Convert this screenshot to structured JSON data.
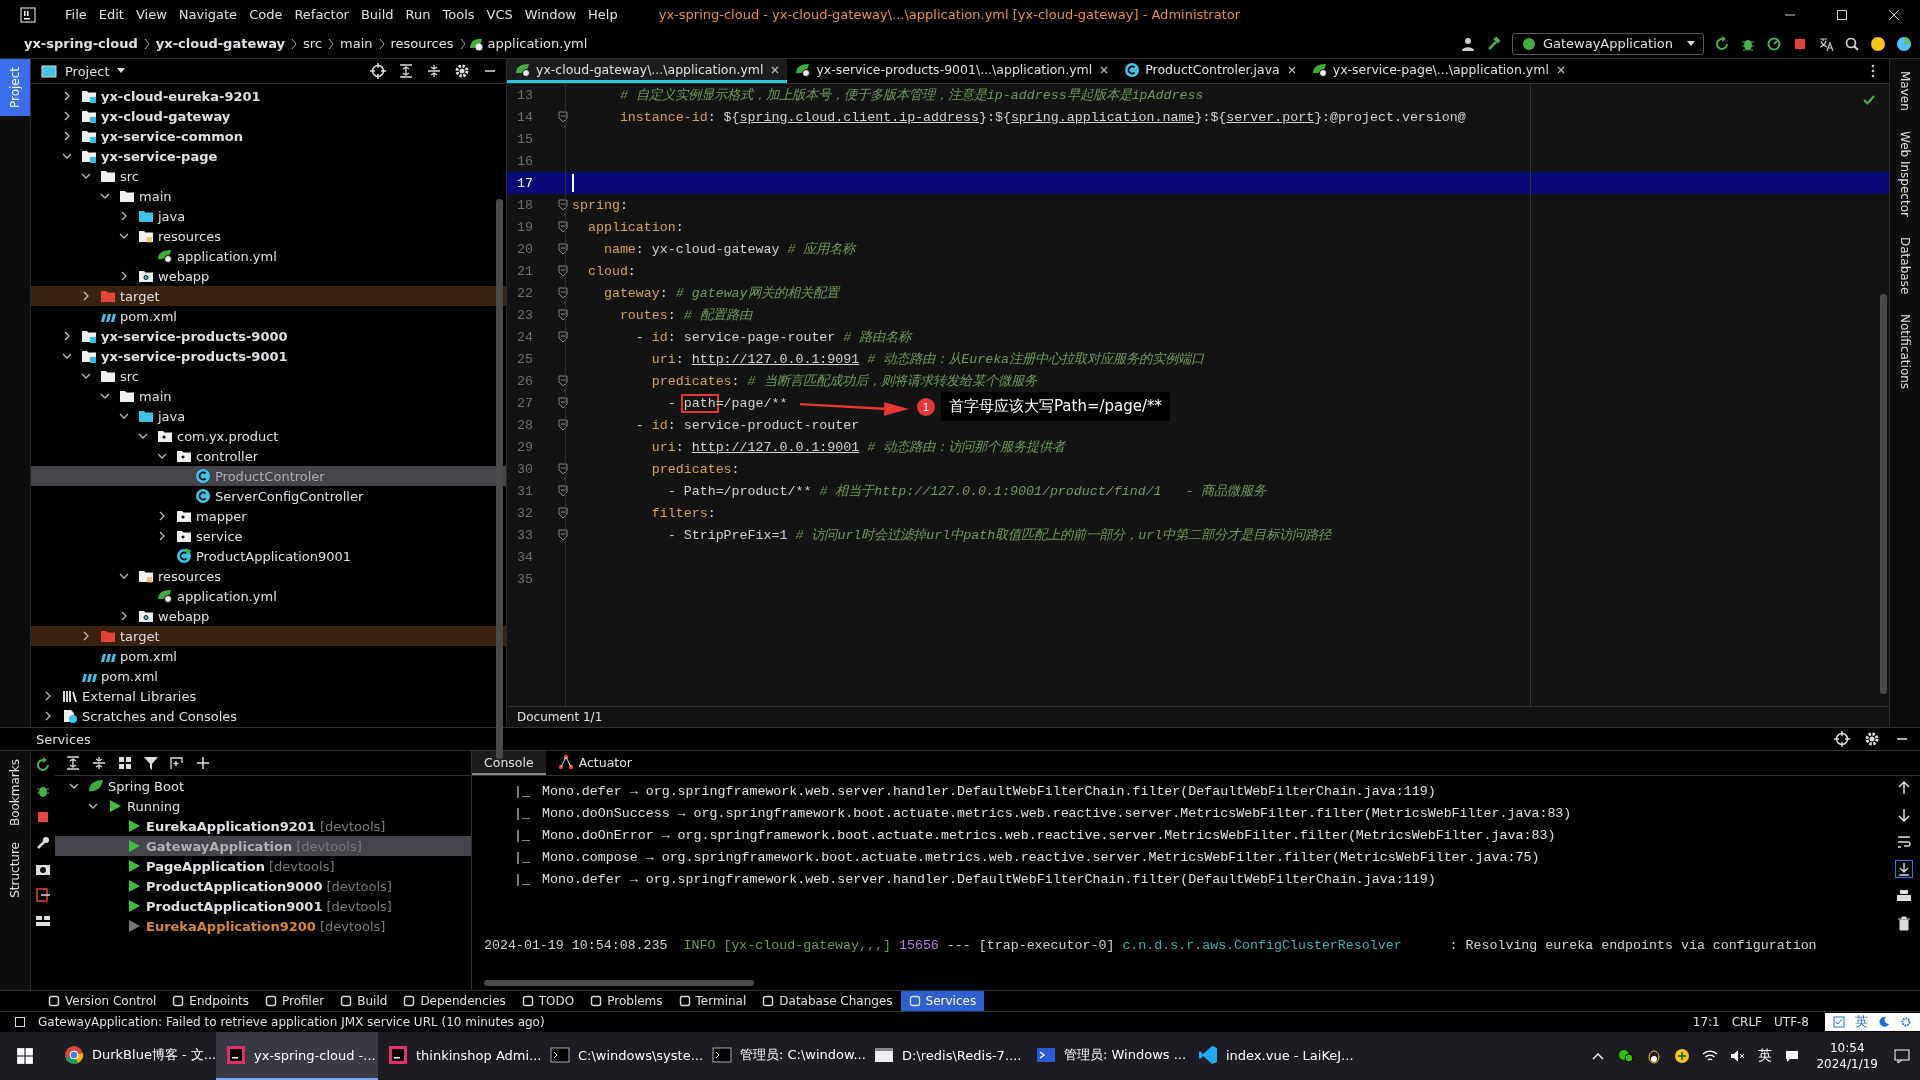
{
  "window": {
    "title": "yx-spring-cloud - yx-cloud-gateway\\...\\application.yml [yx-cloud-gateway] - Administrator"
  },
  "menu": [
    "File",
    "Edit",
    "View",
    "Navigate",
    "Code",
    "Refactor",
    "Build",
    "Run",
    "Tools",
    "VCS",
    "Window",
    "Help"
  ],
  "breadcrumb": [
    {
      "label": "yx-spring-cloud",
      "kind": "module"
    },
    {
      "label": "yx-cloud-gateway",
      "kind": "module"
    },
    {
      "label": "src",
      "kind": "folder"
    },
    {
      "label": "main",
      "kind": "folder"
    },
    {
      "label": "resources",
      "kind": "folder"
    },
    {
      "label": "application.yml",
      "kind": "yaml"
    }
  ],
  "run_config": "GatewayApplication",
  "left_stripe": {
    "top": [
      {
        "label": "Project",
        "selected": true
      }
    ]
  },
  "services_stripe": [
    "Bookmarks",
    "Structure"
  ],
  "right_stripe": [
    "Maven",
    "Web Inspector",
    "Database",
    "Notifications"
  ],
  "project_panel": {
    "title": "Project",
    "tree": {
      "root_children": [
        {
          "label": "yx-cloud-eureka-9201",
          "kind": "module",
          "expanded": false,
          "selected": false
        },
        {
          "label": "yx-cloud-gateway",
          "kind": "module",
          "expanded": false,
          "selected": false
        },
        {
          "label": "yx-service-common",
          "kind": "module",
          "expanded": false,
          "selected": false
        },
        {
          "label": "yx-service-page",
          "kind": "module",
          "expanded": true,
          "selected": false,
          "children": [
            {
              "label": "src",
              "kind": "folder",
              "expanded": true,
              "selected": false,
              "children": [
                {
                  "label": "main",
                  "kind": "folder",
                  "expanded": true,
                  "selected": false,
                  "children": [
                    {
                      "label": "java",
                      "kind": "source",
                      "expanded": false,
                      "selected": false
                    },
                    {
                      "label": "resources",
                      "kind": "resources",
                      "expanded": true,
                      "selected": false,
                      "children": [
                        {
                          "label": "application.yml",
                          "kind": "yaml",
                          "selected": false
                        }
                      ]
                    },
                    {
                      "label": "webapp",
                      "kind": "web",
                      "expanded": false,
                      "selected": false
                    }
                  ]
                }
              ]
            },
            {
              "label": "target",
              "kind": "excluded",
              "expanded": false,
              "selected": false
            },
            {
              "label": "pom.xml",
              "kind": "maven",
              "selected": false
            }
          ]
        },
        {
          "label": "yx-service-products-9000",
          "kind": "module",
          "expanded": false,
          "selected": false
        },
        {
          "label": "yx-service-products-9001",
          "kind": "module",
          "expanded": true,
          "selected": false,
          "children": [
            {
              "label": "src",
              "kind": "folder",
              "expanded": true,
              "selected": false,
              "children": [
                {
                  "label": "main",
                  "kind": "folder",
                  "expanded": true,
                  "selected": false,
                  "children": [
                    {
                      "label": "java",
                      "kind": "source",
                      "expanded": true,
                      "selected": false,
                      "children": [
                        {
                          "label": "com.yx.product",
                          "kind": "package",
                          "expanded": true,
                          "selected": false,
                          "children": [
                            {
                              "label": "controller",
                              "kind": "package",
                              "expanded": true,
                              "selected": false,
                              "children": [
                                {
                                  "label": "ProductControler",
                                  "kind": "class",
                                  "selected": true
                                },
                                {
                                  "label": "ServerConfigController",
                                  "kind": "class",
                                  "selected": false
                                }
                              ]
                            },
                            {
                              "label": "mapper",
                              "kind": "package",
                              "expanded": false,
                              "selected": false
                            },
                            {
                              "label": "service",
                              "kind": "package",
                              "expanded": false,
                              "selected": false
                            },
                            {
                              "label": "ProductApplication9001",
                              "kind": "spring",
                              "selected": false
                            }
                          ]
                        }
                      ]
                    },
                    {
                      "label": "resources",
                      "kind": "resources",
                      "expanded": true,
                      "selected": false,
                      "children": [
                        {
                          "label": "application.yml",
                          "kind": "yaml",
                          "selected": false
                        }
                      ]
                    },
                    {
                      "label": "webapp",
                      "kind": "web",
                      "expanded": false,
                      "selected": false
                    }
                  ]
                }
              ]
            },
            {
              "label": "target",
              "kind": "excluded",
              "expanded": false,
              "selected": false
            },
            {
              "label": "pom.xml",
              "kind": "maven",
              "selected": false
            }
          ]
        },
        {
          "label": "pom.xml",
          "kind": "maven",
          "selected": false
        }
      ],
      "siblings": [
        {
          "label": "External Libraries",
          "kind": "libraries",
          "expanded": false,
          "selected": false
        },
        {
          "label": "Scratches and Consoles",
          "kind": "scratches",
          "expanded": false,
          "selected": false
        }
      ]
    }
  },
  "editor": {
    "tabs": [
      {
        "label": "yx-cloud-gateway\\...\\application.yml",
        "kind": "yaml",
        "selected": true
      },
      {
        "label": "yx-service-products-9001\\...\\application.yml",
        "kind": "yaml",
        "selected": false
      },
      {
        "label": "ProductControler.java",
        "kind": "class",
        "selected": false
      },
      {
        "label": "yx-service-page\\...\\application.yml",
        "kind": "yaml",
        "selected": false
      }
    ],
    "lines": [
      {
        "number": "13",
        "current": false,
        "fold": false,
        "segments": [
          {
            "kind": "comment",
            "text": "      # 自定义实例显示格式，加上版本号，便于多版本管理，注意是ip-address早起版本是ipAddress"
          }
        ]
      },
      {
        "number": "14",
        "current": false,
        "fold": true,
        "segments": [
          {
            "kind": "key",
            "text": "      instance-id"
          },
          {
            "kind": "plain",
            "text": ": ${"
          },
          {
            "kind": "link",
            "text": "spring.cloud.client.ip-address"
          },
          {
            "kind": "plain",
            "text": "}:${"
          },
          {
            "kind": "link",
            "text": "spring.application.name"
          },
          {
            "kind": "plain",
            "text": "}:${"
          },
          {
            "kind": "link",
            "text": "server.port"
          },
          {
            "kind": "plain",
            "text": "}:@project.version@"
          }
        ]
      },
      {
        "number": "15",
        "current": false,
        "fold": false
      },
      {
        "number": "16",
        "current": false,
        "fold": false
      },
      {
        "number": "17",
        "current": true,
        "fold": false
      },
      {
        "number": "18",
        "current": false,
        "fold": true,
        "segments": [
          {
            "kind": "key",
            "text": "spring"
          },
          {
            "kind": "plain",
            "text": ":"
          }
        ]
      },
      {
        "number": "19",
        "current": false,
        "fold": true,
        "segments": [
          {
            "kind": "key",
            "text": "  application"
          },
          {
            "kind": "plain",
            "text": ":"
          }
        ]
      },
      {
        "number": "20",
        "current": false,
        "fold": true,
        "segments": [
          {
            "kind": "key",
            "text": "    name"
          },
          {
            "kind": "plain",
            "text": ": yx-cloud-gateway "
          },
          {
            "kind": "comment",
            "text": "# 应用名称"
          }
        ]
      },
      {
        "number": "21",
        "current": false,
        "fold": true,
        "segments": [
          {
            "kind": "key",
            "text": "  cloud"
          },
          {
            "kind": "plain",
            "text": ":"
          }
        ]
      },
      {
        "number": "22",
        "current": false,
        "fold": true,
        "segments": [
          {
            "kind": "key",
            "text": "    gateway"
          },
          {
            "kind": "plain",
            "text": ": "
          },
          {
            "kind": "comment",
            "text": "# gateway网关的相关配置"
          }
        ]
      },
      {
        "number": "23",
        "current": false,
        "fold": true,
        "segments": [
          {
            "kind": "key",
            "text": "      routes"
          },
          {
            "kind": "plain",
            "text": ": "
          },
          {
            "kind": "comment",
            "text": "# 配置路由"
          }
        ]
      },
      {
        "number": "24",
        "current": false,
        "fold": true,
        "segments": [
          {
            "kind": "plain",
            "text": "        - "
          },
          {
            "kind": "key",
            "text": "id"
          },
          {
            "kind": "plain",
            "text": ": service-page-router "
          },
          {
            "kind": "comment",
            "text": "# 路由名称"
          }
        ]
      },
      {
        "number": "25",
        "current": false,
        "fold": false,
        "segments": [
          {
            "kind": "key",
            "text": "          uri"
          },
          {
            "kind": "plain",
            "text": ": "
          },
          {
            "kind": "link",
            "text": "http://127.0.0.1:9091"
          },
          {
            "kind": "comment",
            "text": " # 动态路由：从Eureka注册中心拉取对应服务的实例端口"
          }
        ]
      },
      {
        "number": "26",
        "current": false,
        "fold": true,
        "segments": [
          {
            "kind": "key",
            "text": "          predicates"
          },
          {
            "kind": "plain",
            "text": ": "
          },
          {
            "kind": "comment",
            "text": "# 当断言匹配成功后，则将请求转发给某个微服务"
          }
        ]
      },
      {
        "number": "27",
        "current": false,
        "fold": true,
        "segments": [
          {
            "kind": "plain",
            "text": "            - "
          },
          {
            "kind": "boxed",
            "text": "path"
          },
          {
            "kind": "plain",
            "text": "=/page/**"
          }
        ]
      },
      {
        "number": "28",
        "current": false,
        "fold": true,
        "segments": [
          {
            "kind": "plain",
            "text": "        - "
          },
          {
            "kind": "key",
            "text": "id"
          },
          {
            "kind": "plain",
            "text": ": service-product-router"
          }
        ]
      },
      {
        "number": "29",
        "current": false,
        "fold": false,
        "segments": [
          {
            "kind": "key",
            "text": "          uri"
          },
          {
            "kind": "plain",
            "text": ": "
          },
          {
            "kind": "link",
            "text": "http://127.0.0.1:9001"
          },
          {
            "kind": "comment",
            "text": " # 动态路由：访问那个服务提供者"
          }
        ]
      },
      {
        "number": "30",
        "current": false,
        "fold": true,
        "segments": [
          {
            "kind": "key",
            "text": "          predicates"
          },
          {
            "kind": "plain",
            "text": ":"
          }
        ]
      },
      {
        "number": "31",
        "current": false,
        "fold": true,
        "segments": [
          {
            "kind": "plain",
            "text": "            - Path=/product/** "
          },
          {
            "kind": "comment",
            "text": "# 相当于http://127.0.0.1:9001/product/find/1   - 商品微服务"
          }
        ]
      },
      {
        "number": "32",
        "current": false,
        "fold": true,
        "segments": [
          {
            "kind": "key",
            "text": "          filters"
          },
          {
            "kind": "plain",
            "text": ":"
          }
        ]
      },
      {
        "number": "33",
        "current": false,
        "fold": true,
        "segments": [
          {
            "kind": "plain",
            "text": "            - StripPreFix=1 "
          },
          {
            "kind": "comment",
            "text": "# 访问url时会过滤掉url中path取值匹配上的前一部分，url中第二部分才是目标访问路径"
          }
        ]
      },
      {
        "number": "34",
        "current": false,
        "fold": false
      },
      {
        "number": "35",
        "current": false,
        "fold": false
      }
    ],
    "status": "Document 1/1"
  },
  "annotation": {
    "number": "1",
    "text": "首字母应该大写Path=/page/**"
  },
  "services": {
    "title": "Services",
    "tree": [
      {
        "label": "Spring Boot",
        "kind": "springboot",
        "expanded": true,
        "selected": false,
        "children": [
          {
            "label": "Running",
            "kind": "group",
            "expanded": true,
            "selected": false,
            "children": [
              {
                "label": "EurekaApplication9201",
                "suffix": "[devtools]",
                "kind": "running",
                "selected": false
              },
              {
                "label": "GatewayApplication",
                "suffix": "[devtools]",
                "kind": "running",
                "selected": true
              },
              {
                "label": "PageApplication",
                "suffix": "[devtools]",
                "kind": "running",
                "selected": false
              },
              {
                "label": "ProductApplication9000",
                "suffix": "[devtools]",
                "kind": "running",
                "selected": false
              },
              {
                "label": "ProductApplication9001",
                "suffix": "[devtools]",
                "kind": "running",
                "selected": false
              },
              {
                "label": "EurekaApplication9200",
                "suffix": "[devtools]",
                "kind": "stopped",
                "selected": false
              }
            ]
          }
        ]
      }
    ],
    "tabs": [
      {
        "label": "Console",
        "kind": "console",
        "selected": true
      },
      {
        "label": "Actuator",
        "kind": "actuator",
        "selected": false
      }
    ],
    "console": [
      {
        "kind": "trace",
        "marker": "|_",
        "text": "Mono.defer → org.springframework.web.server.handler.DefaultWebFilterChain.filter(DefaultWebFilterChain.java:119)"
      },
      {
        "kind": "trace",
        "marker": "|_",
        "text": "Mono.doOnSuccess → org.springframework.boot.actuate.metrics.web.reactive.server.MetricsWebFilter.filter(MetricsWebFilter.java:83)"
      },
      {
        "kind": "trace",
        "marker": "|_",
        "text": "Mono.doOnError → org.springframework.boot.actuate.metrics.web.reactive.server.MetricsWebFilter.filter(MetricsWebFilter.java:83)"
      },
      {
        "kind": "trace",
        "marker": "|_",
        "text": "Mono.compose → org.springframework.boot.actuate.metrics.web.reactive.server.MetricsWebFilter.filter(MetricsWebFilter.java:75)"
      },
      {
        "kind": "trace",
        "marker": "|_",
        "text": "Mono.defer → org.springframework.web.server.handler.DefaultWebFilterChain.filter(DefaultWebFilterChain.java:119)"
      },
      {
        "kind": "log",
        "parts": [
          {
            "kind": "time",
            "text": "2024-01-19 10:54:08.235  "
          },
          {
            "kind": "level",
            "text": "INFO [yx-cloud-gateway,,,] "
          },
          {
            "kind": "pid",
            "text": "15656"
          },
          {
            "kind": "plain",
            "text": " --- [trap-executor-0] "
          },
          {
            "kind": "logger",
            "text": "c.n.d.s.r.aws.ConfigClusterResolver"
          },
          {
            "kind": "plain",
            "text": "      : Resolving eureka endpoints via configuration"
          }
        ]
      }
    ]
  },
  "tool_windows": [
    {
      "label": "Version Control",
      "selected": false
    },
    {
      "label": "Endpoints",
      "selected": false
    },
    {
      "label": "Profiler",
      "selected": false
    },
    {
      "label": "Build",
      "selected": false
    },
    {
      "label": "Dependencies",
      "selected": false
    },
    {
      "label": "TODO",
      "selected": false
    },
    {
      "label": "Problems",
      "selected": false
    },
    {
      "label": "Terminal",
      "selected": false
    },
    {
      "label": "Database Changes",
      "selected": false
    },
    {
      "label": "Services",
      "selected": true
    }
  ],
  "status_bar": {
    "message": "GatewayApplication: Failed to retrieve application JMX service URL (10 minutes ago)",
    "position": "17:1",
    "line_ending": "CRLF",
    "encoding": "UTF-8",
    "ime": "英"
  },
  "taskbar": {
    "items": [
      {
        "label": "DurkBlue博客 - 文...",
        "kind": "browser",
        "selected": false
      },
      {
        "label": "yx-spring-cloud -...",
        "kind": "ide",
        "selected": true
      },
      {
        "label": "thinkinshop Admi...",
        "kind": "ide",
        "selected": false
      },
      {
        "label": "C:\\windows\\syste...",
        "kind": "console",
        "selected": false
      },
      {
        "label": "管理员: C:\\window...",
        "kind": "console",
        "selected": false
      },
      {
        "label": "D:\\redis\\Redis-7....",
        "kind": "window",
        "selected": false
      },
      {
        "label": "管理员: Windows ...",
        "kind": "shell",
        "selected": false
      },
      {
        "label": "index.vue - LaiKeJ...",
        "kind": "code",
        "selected": false
      }
    ],
    "ime": "英",
    "time": "10:54",
    "date": "2024/1/19"
  }
}
